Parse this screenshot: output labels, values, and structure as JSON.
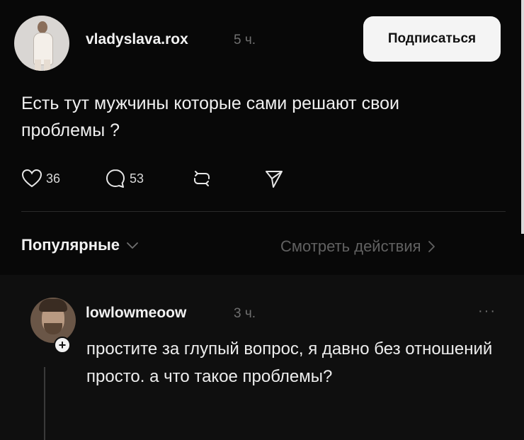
{
  "post": {
    "author": "vladyslava.rox",
    "time": "5 ч.",
    "follow_label": "Подписаться",
    "text": "Есть тут мужчины которые сами решают свои проблемы ?",
    "likes": "36",
    "replies": "53",
    "icons": [
      "heart-icon",
      "comment-icon",
      "repost-icon",
      "share-icon"
    ]
  },
  "filters": {
    "sort_label": "Популярные",
    "view_activity_label": "Смотреть действия"
  },
  "comment": {
    "author": "lowlowmeoow",
    "time": "3 ч.",
    "more_label": "···",
    "follow_badge": "+",
    "text": "простите за глупый вопрос, я давно без отношений просто. а что такое проблемы?"
  },
  "colors": {
    "background": "#0b0b0b",
    "text": "#f2f2f2",
    "muted": "#6f6f6f",
    "button_bg": "#f4f4f4"
  }
}
